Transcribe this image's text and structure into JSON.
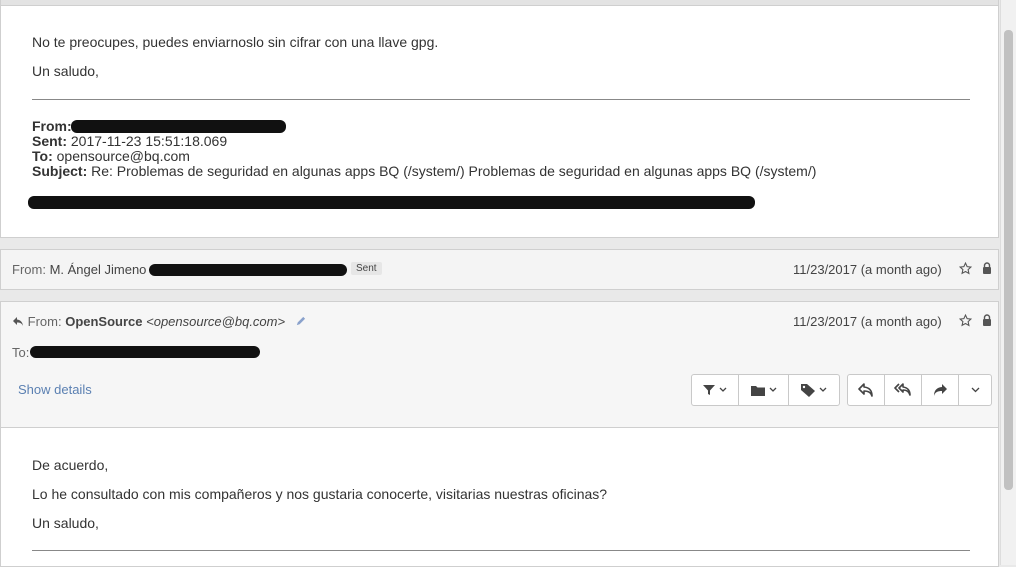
{
  "message1": {
    "line1": "No te preocupes, puedes enviarnoslo sin cifrar con una llave gpg.",
    "line2": "Un saludo,",
    "quote": {
      "from_label": "From:",
      "sent_label": "Sent:",
      "sent_value": "2017-11-23 15:51:18.069",
      "to_label": "To:",
      "to_value": "opensource@bq.com",
      "subject_label": "Subject:",
      "subject_value": "Re: Problemas de seguridad en algunas apps BQ (/system/) Problemas de seguridad en algunas apps BQ (/system/)"
    }
  },
  "collapsed": {
    "from_label": "From:",
    "sender": "M. Ángel Jimeno <",
    "badge": "Sent",
    "date": "11/23/2017 (a month ago)"
  },
  "open": {
    "from_label": "From:",
    "sender_name": "OpenSource",
    "sender_email": "<opensource@bq.com>",
    "date": "11/23/2017 (a month ago)",
    "to_label": "To:",
    "show_details": "Show details"
  },
  "message2": {
    "line1": "De acuerdo,",
    "line2": "Lo he consultado con mis compañeros y nos gustaria conocerte, visitarias nuestras oficinas?",
    "line3": "Un saludo,"
  },
  "colors": {
    "accent": "#5b80b2",
    "text": "#333333",
    "panel": "#ffffff"
  }
}
